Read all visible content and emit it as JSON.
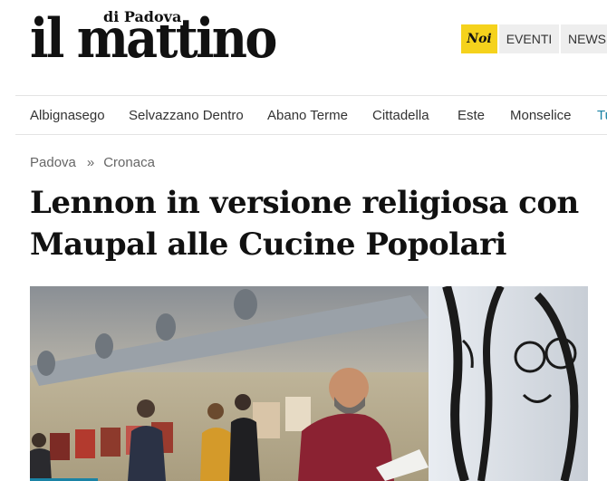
{
  "logo": {
    "main": "il mattino",
    "sub": "di Padova"
  },
  "top_buttons": {
    "noi": "Noi",
    "eventi": "EVENTI",
    "news": "NEWSL"
  },
  "nav": {
    "items": [
      {
        "label": "Albignasego"
      },
      {
        "label": "Selvazzano Dentro"
      },
      {
        "label": "Abano Terme"
      },
      {
        "label": "Cittadella"
      },
      {
        "label": "Este"
      },
      {
        "label": "Monselice"
      },
      {
        "label": "Tu"
      }
    ]
  },
  "breadcrumb": {
    "items": [
      "Padova",
      "Cronaca"
    ],
    "separator": "»"
  },
  "article": {
    "headline_line1": "Lennon in versione religiosa con",
    "headline_line2": "Maupal alle Cucine Popolari"
  },
  "colors": {
    "accent": "#1a83a5",
    "noi_bg": "#f5d21c",
    "button_bg": "#eeeeee",
    "text": "#111111"
  },
  "icons": {
    "photo": "article-photo"
  }
}
